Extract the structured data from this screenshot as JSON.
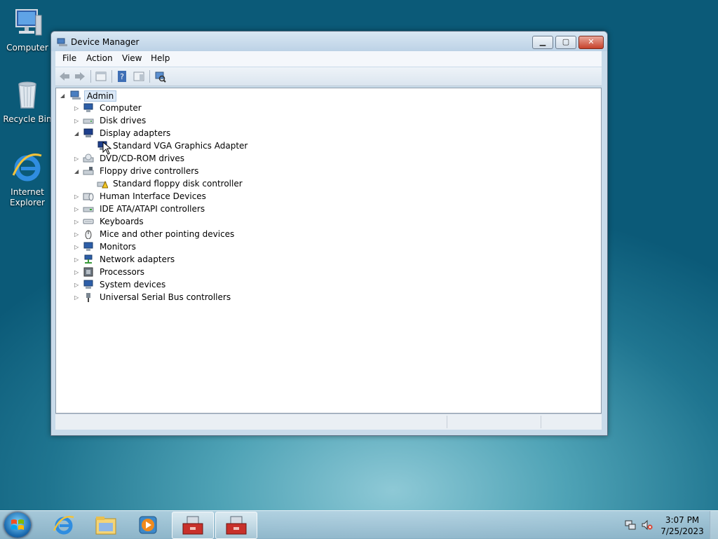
{
  "desktop": {
    "icons": [
      {
        "label": "Computer",
        "icon": "computer-icon"
      },
      {
        "label": "Recycle Bin",
        "icon": "recycle-bin-icon"
      },
      {
        "label_line1": "Internet",
        "label_line2": "Explorer",
        "icon": "internet-explorer-icon"
      }
    ]
  },
  "window": {
    "title": "Device Manager",
    "menu": [
      "File",
      "Action",
      "View",
      "Help"
    ],
    "toolbar": [
      "back-icon",
      "forward-icon",
      "properties-pane-icon",
      "help-icon",
      "show-hide-icon",
      "scan-hardware-icon"
    ]
  },
  "tree": {
    "root": "Admin",
    "nodes": [
      {
        "label": "Computer",
        "expanded": false
      },
      {
        "label": "Disk drives",
        "expanded": false
      },
      {
        "label": "Display adapters",
        "expanded": true
      },
      {
        "label": "Standard VGA Graphics Adapter",
        "child": true
      },
      {
        "label": "DVD/CD-ROM drives",
        "expanded": false
      },
      {
        "label": "Floppy drive controllers",
        "expanded": true
      },
      {
        "label": "Standard floppy disk controller",
        "child": true
      },
      {
        "label": "Human Interface Devices",
        "expanded": false
      },
      {
        "label": "IDE ATA/ATAPI controllers",
        "expanded": false
      },
      {
        "label": "Keyboards",
        "expanded": false
      },
      {
        "label": "Mice and other pointing devices",
        "expanded": false
      },
      {
        "label": "Monitors",
        "expanded": false
      },
      {
        "label": "Network adapters",
        "expanded": false
      },
      {
        "label": "Processors",
        "expanded": false
      },
      {
        "label": "System devices",
        "expanded": false
      },
      {
        "label": "Universal Serial Bus controllers",
        "expanded": false
      }
    ]
  },
  "taskbar": {
    "clock_time": "3:07 PM",
    "clock_date": "7/25/2023",
    "pinned": [
      "internet-explorer-icon",
      "windows-explorer-icon",
      "media-player-icon",
      "device-manager-icon",
      "device-manager-icon"
    ]
  },
  "colors": {
    "selection": "#dce9f7",
    "accent": "#1f7590"
  }
}
